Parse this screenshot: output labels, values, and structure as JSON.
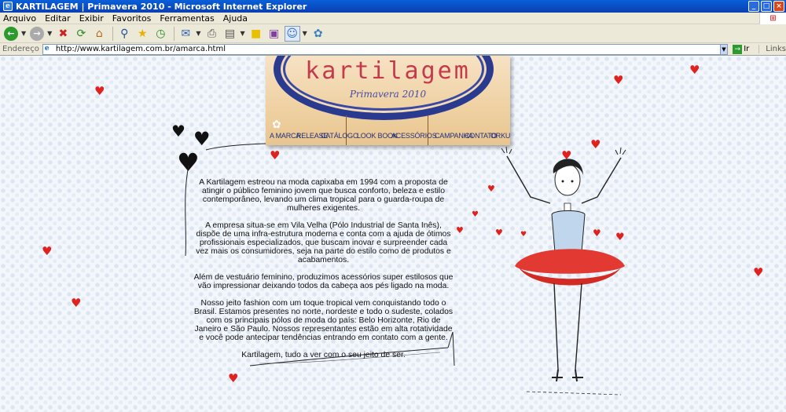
{
  "window": {
    "title": "KARTILAGEM | Primavera 2010 - Microsoft Internet Explorer",
    "controls": [
      "_",
      "□",
      "×"
    ]
  },
  "menu": [
    "Arquivo",
    "Editar",
    "Exibir",
    "Favoritos",
    "Ferramentas",
    "Ajuda"
  ],
  "address": {
    "label": "Endereço",
    "url": "http://www.kartilagem.com.br/amarca.html",
    "go_label": "Ir",
    "links_label": "Links"
  },
  "site": {
    "brand": "kartilagem",
    "season": "Primavera 2010",
    "nav": [
      "A MARCA",
      "RELEASE",
      "CATÁLOGO",
      "LOOK BOOK",
      "ACESSÓRIOS",
      "CAMPANHA",
      "CONTATO",
      "ORKUT"
    ],
    "paragraphs": [
      "A Kartilagem estreou na moda capixaba em 1994 com a proposta de atingir o público feminino jovem que busca conforto, beleza e estilo contemporâneo, levando um clima tropical para o guarda-roupa de mulheres exigentes.",
      "A empresa situa-se em Vila Velha (Pólo Industrial de Santa Inês), dispõe de uma infra-estrutura moderna e conta com a ajuda de ótimos profissionais especializados, que buscam inovar e surpreender cada vez mais os consumidores, seja na parte do estilo como de produtos e acabamentos.",
      "Além de vestuário feminino, produzimos acessórios super estilosos que vão impressionar deixando todos da cabeça aos pés ligado na moda.",
      "Nosso jeito fashion com um toque tropical vem conquistando todo o Brasil. Estamos presentes no norte, nordeste e todo o sudeste, colados com os principais pólos de moda do país: Belo Horizonte, Rio de Janeiro e São Paulo. Nossos representantes estão em alta rotatividade e você pode antecipar tendências entrando em contato com a gente.",
      "Kartilagem, tudo a ver com o seu jeito de ser."
    ]
  },
  "colors": {
    "heart": "#e0221e",
    "nav_text": "#24307a",
    "brand_text": "#c43a4a"
  }
}
